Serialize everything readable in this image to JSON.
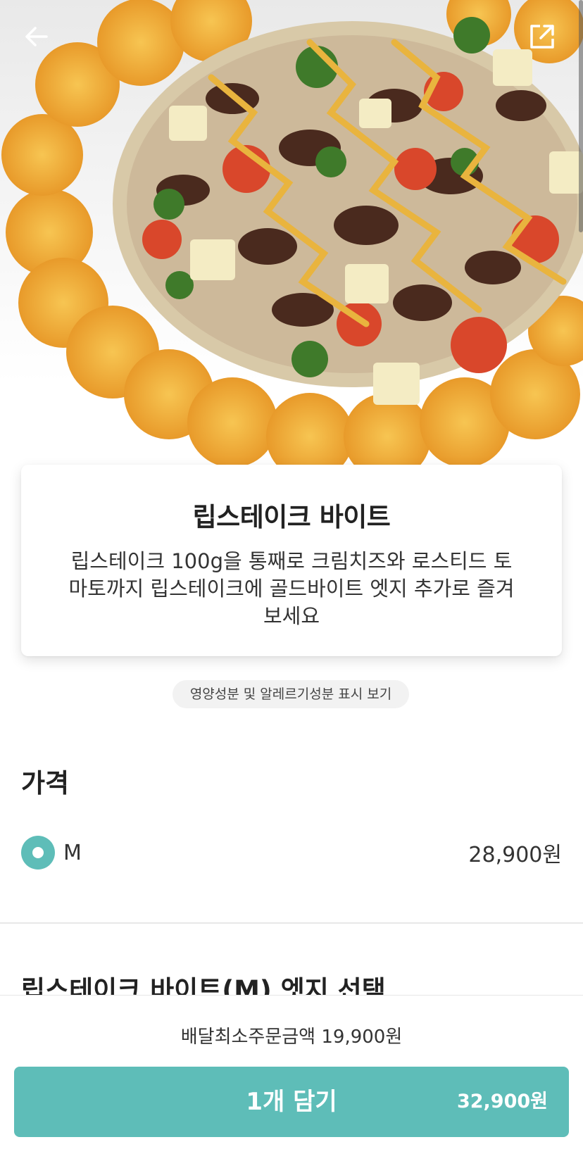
{
  "product": {
    "name": "립스테이크 바이트",
    "description": "립스테이크 100g을 통째로 크림치즈와 로스티드 토마토까지 립스테이크에 골드바이트 엣지 추가로 즐겨보세요",
    "image_icon": "pizza-photo"
  },
  "links": {
    "nutrition": "영양성분 및 알레르기성분 표시 보기"
  },
  "price_section": {
    "title": "가격",
    "options": [
      {
        "label": "M",
        "price": "28,900원",
        "selected": true
      }
    ]
  },
  "edge_section": {
    "title": "립스테이크 바이트(M) 엣지 선택"
  },
  "footer": {
    "min_order": "배달최소주문금액 19,900원",
    "cart_label": "1개 담기",
    "cart_total": "32,900원"
  },
  "icons": {
    "back": "arrow-left-icon",
    "share": "share-icon"
  },
  "colors": {
    "accent": "#5ebdb8",
    "text": "#222222"
  }
}
